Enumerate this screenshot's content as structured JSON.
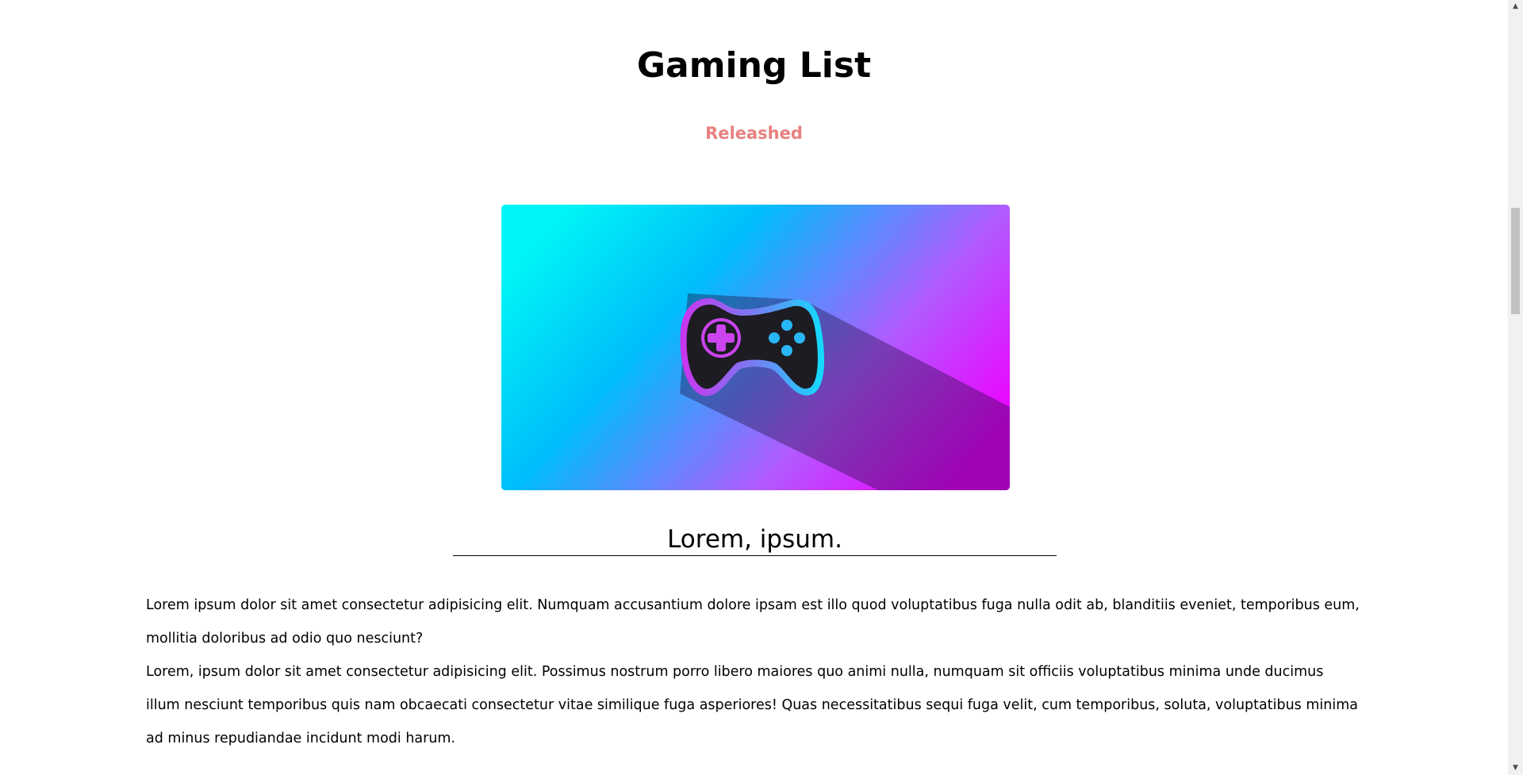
{
  "page": {
    "title": "Gaming List",
    "status": "Releashed",
    "status_color": "#e88080"
  },
  "hero_image": {
    "icon": "gamepad-icon",
    "gradient": [
      "#00f6f6",
      "#00bdfb",
      "#b15bff",
      "#ee00ff"
    ]
  },
  "article": {
    "heading": "Lorem, ipsum.",
    "paragraphs": [
      "Lorem ipsum dolor sit amet consectetur adipisicing elit. Numquam accusantium dolore ipsam est illo quod voluptatibus fuga nulla odit ab, blanditiis eveniet, temporibus eum, mollitia doloribus ad odio quo nesciunt?",
      "Lorem, ipsum dolor sit amet consectetur adipisicing elit. Possimus nostrum porro libero maiores quo animi nulla, numquam sit officiis voluptatibus minima unde ducimus illum nesciunt temporibus quis nam obcaecati consectetur vitae similique fuga asperiores! Quas necessitatibus sequi fuga velit, cum temporibus, soluta, voluptatibus minima ad minus repudiandae incidunt modi harum."
    ]
  },
  "scrollbar": {
    "up_icon": "arrow-up-icon",
    "down_icon": "arrow-down-icon"
  }
}
